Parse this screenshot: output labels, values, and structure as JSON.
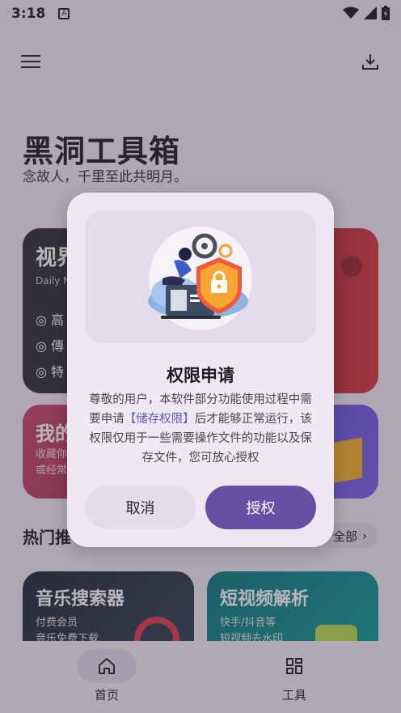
{
  "status_bar": {
    "time": "3:18",
    "notification_glyph": "A"
  },
  "app": {
    "title": "黑洞工具箱",
    "subtitle": "念故人，千里至此共明月。"
  },
  "cards": {
    "video": {
      "title": "视界",
      "sub": "Daily N",
      "bullets": [
        "高",
        "傳",
        "特"
      ]
    },
    "mine": {
      "title": "我的",
      "sub_line1": "收藏你",
      "sub_line2": "或经常"
    }
  },
  "section": {
    "title": "热门推",
    "all_label": "全部"
  },
  "tools": [
    {
      "title": "音乐搜索器",
      "line1": "付费会员",
      "line2": "音乐免费下载"
    },
    {
      "title": "短视频解析",
      "line1": "快手/抖音等",
      "line2": "短视频去水印"
    }
  ],
  "bottom_nav": [
    {
      "label": "首页",
      "icon": "home-icon"
    },
    {
      "label": "工具",
      "icon": "grid-icon"
    }
  ],
  "dialog": {
    "title": "权限申请",
    "body_before": "尊敬的用户，本软件部分功能使用过程中需要申请",
    "body_highlight": "【储存权限】",
    "body_after": "后才能够正常运行，该权限仅用于一些需要操作文件的功能以及保存文件，您可放心授权",
    "cancel_label": "取消",
    "grant_label": "授权"
  },
  "colors": {
    "accent": "#6750a4",
    "highlight_text": "#5c60b8"
  }
}
